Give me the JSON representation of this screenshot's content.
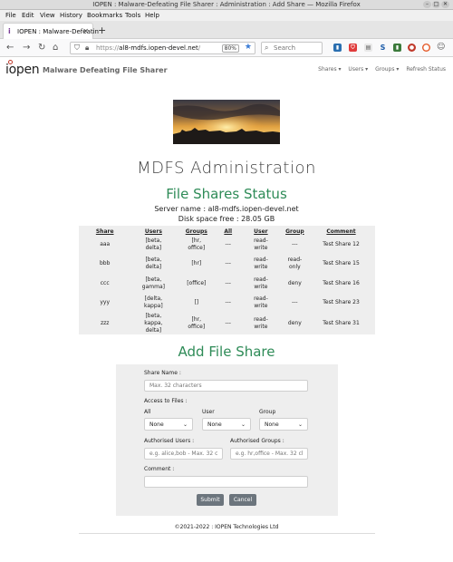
{
  "window": {
    "title": "IOPEN : Malware-Defeating File Sharer : Administration : Add Share — Mozilla Firefox"
  },
  "menu": [
    "File",
    "Edit",
    "View",
    "History",
    "Bookmarks",
    "Tools",
    "Help"
  ],
  "tab": {
    "label": "IOPEN : Malware-Defeatin",
    "close": "✕"
  },
  "nav": {
    "url_prefix": "https://",
    "url_host": "al8-mdfs.iopen-devel.net",
    "url_suffix": "/",
    "zoom": "80%",
    "search_placeholder": "Search"
  },
  "site": {
    "logo": "iopen",
    "app_name": "Malware Defeating File Sharer",
    "nav": [
      "Shares ▾",
      "Users ▾",
      "Groups ▾",
      "Refresh Status"
    ]
  },
  "heading": "MDFS Administration",
  "status": {
    "title": "File Shares Status",
    "server_line": "Server name : al8-mdfs.iopen-devel.net",
    "disk_line": "Disk space free : 28.05 GB"
  },
  "table": {
    "headers": [
      "Share",
      "Users",
      "Groups",
      "All",
      "User",
      "Group",
      "Comment"
    ],
    "rows": [
      [
        "aaa",
        "[beta,\ndelta]",
        "[hr,\noffice]",
        "---",
        "read-\nwrite",
        "---",
        "Test Share 12"
      ],
      [
        "bbb",
        "[beta,\ndelta]",
        "[hr]",
        "---",
        "read-\nwrite",
        "read-\nonly",
        "Test Share 15"
      ],
      [
        "ccc",
        "[beta,\ngamma]",
        "[office]",
        "---",
        "read-\nwrite",
        "deny",
        "Test Share 16"
      ],
      [
        "yyy",
        "[delta,\nkappa]",
        "[]",
        "---",
        "read-\nwrite",
        "---",
        "Test Share 23"
      ],
      [
        "zzz",
        "[beta,\nkappa,\ndelta]",
        "[hr,\noffice]",
        "---",
        "read-\nwrite",
        "deny",
        "Test Share 31"
      ]
    ]
  },
  "form": {
    "title": "Add File Share",
    "share_name_label": "Share Name :",
    "share_name_placeholder": "Max. 32 characters",
    "access_label": "Access to Files :",
    "all_label": "All",
    "user_label": "User",
    "group_label": "Group",
    "all_value": "None",
    "user_value": "None",
    "group_value": "None",
    "auth_users_label": "Authorised Users :",
    "auth_users_placeholder": "e.g. alice,bob - Max. 32 ch",
    "auth_groups_label": "Authorised Groups :",
    "auth_groups_placeholder": "e.g. hr,office - Max. 32 chu",
    "comment_label": "Comment :",
    "submit": "Submit",
    "cancel": "Cancel"
  },
  "footer": "©2021-2022 : IOPEN Technologies Ltd",
  "colors": {
    "accent_green": "#2e8b57",
    "button_gray": "#6c757d",
    "panel_gray": "#eeeeee"
  }
}
